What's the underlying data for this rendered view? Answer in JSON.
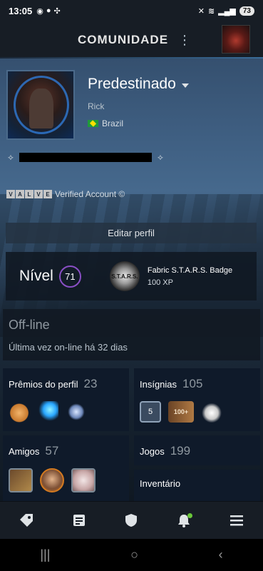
{
  "status_bar": {
    "time": "13:05",
    "battery": "73"
  },
  "header": {
    "title": "COMUNIDADE"
  },
  "profile": {
    "name": "Predestinado",
    "real_name": "Rick",
    "country": "Brazil",
    "verified_logo": "VALVE",
    "verified_text": "Verified Account ©"
  },
  "actions": {
    "edit_label": "Editar perfil"
  },
  "level": {
    "label": "Nível",
    "value": "71",
    "badge_name": "Fabric S.T.A.R.S. Badge",
    "badge_xp": "100 XP",
    "badge_logo": "S.T.A.R.S."
  },
  "status": {
    "state": "Off-line",
    "last_seen": "Última vez on-line há 32 dias"
  },
  "cards": {
    "awards": {
      "label": "Prêmios do perfil",
      "count": "23"
    },
    "badges": {
      "label": "Insígnias",
      "count": "105",
      "items": [
        "5",
        "100+"
      ]
    },
    "friends": {
      "label": "Amigos",
      "count": "57"
    },
    "games": {
      "label": "Jogos",
      "count": "199"
    },
    "inventory": {
      "label": "Inventário"
    }
  },
  "nav": {
    "items": [
      "tag-icon",
      "news-icon",
      "shield-icon",
      "bell-icon",
      "menu-icon"
    ],
    "notification_color": "#6ac73a"
  },
  "system_nav": {
    "recents": "|||",
    "home": "○",
    "back": "‹"
  }
}
